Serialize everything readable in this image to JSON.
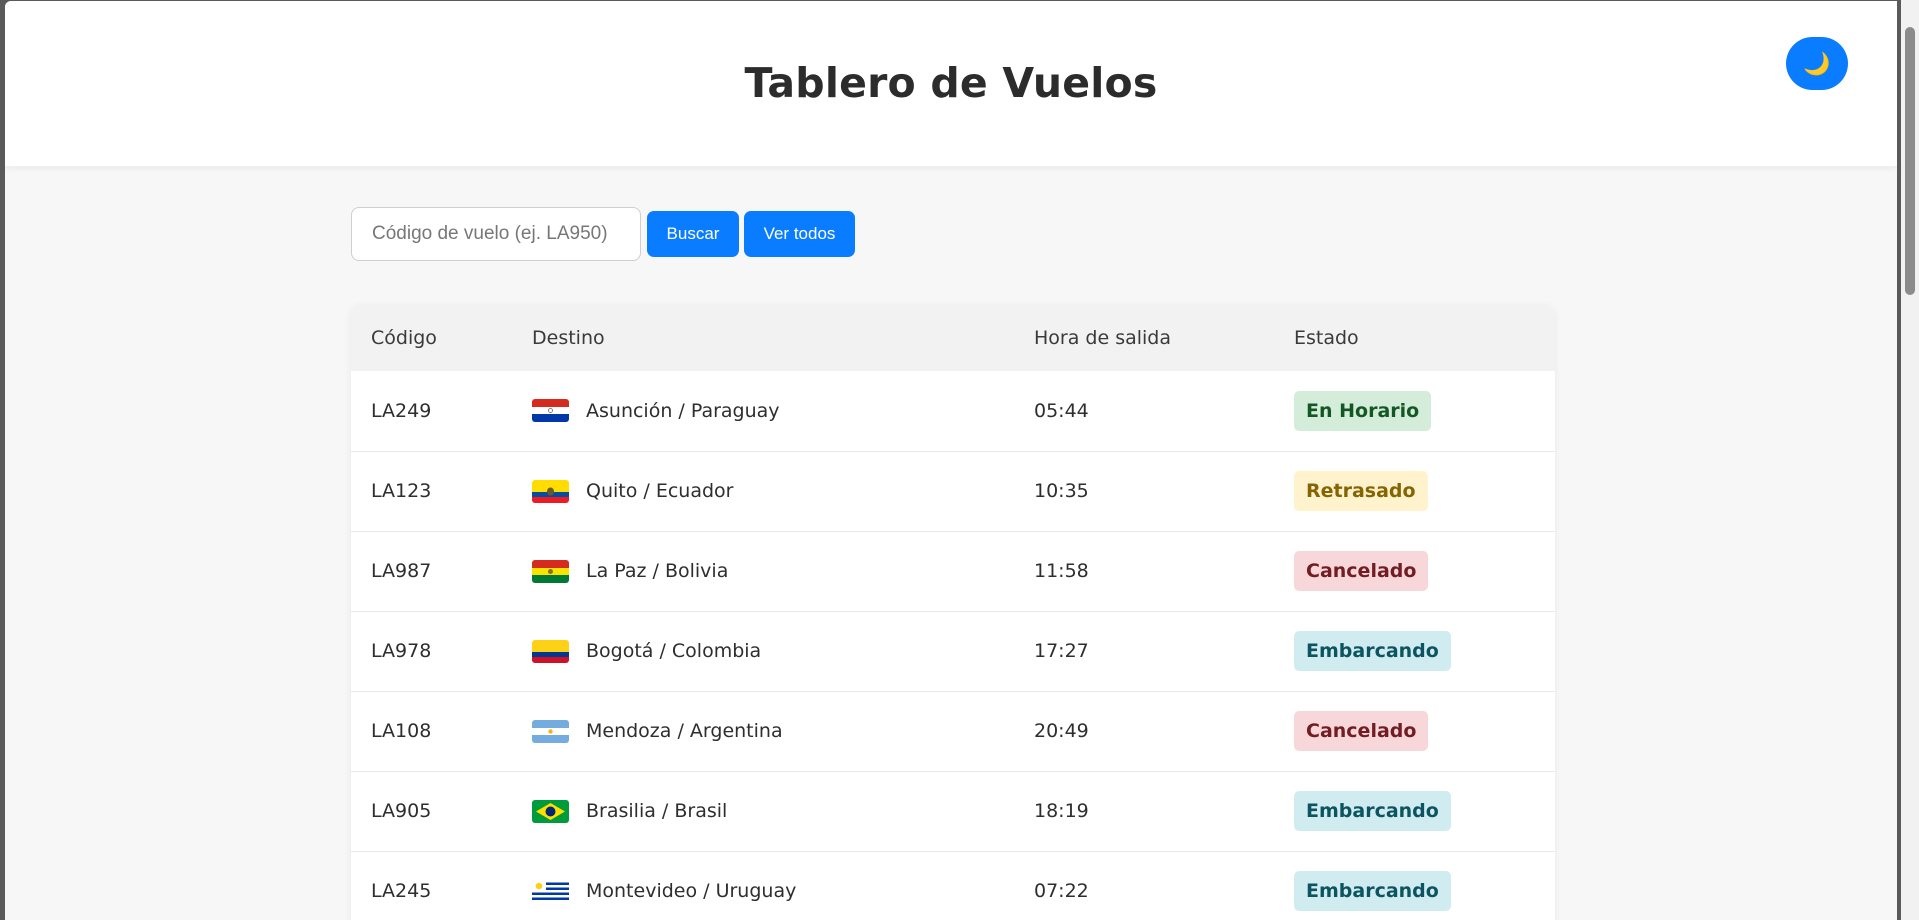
{
  "header": {
    "title": "Tablero de Vuelos",
    "theme_icon": "moon-icon",
    "theme_glyph": "🌙"
  },
  "search": {
    "placeholder": "Código de vuelo (ej. LA950)",
    "value": "",
    "search_label": "Buscar",
    "show_all_label": "Ver todos"
  },
  "table": {
    "columns": [
      "Código",
      "Destino",
      "Hora de salida",
      "Estado"
    ],
    "rows": [
      {
        "code": "LA249",
        "destination": "Asunción / Paraguay",
        "flag": "paraguay-flag-icon",
        "time": "05:44",
        "status": "En Horario"
      },
      {
        "code": "LA123",
        "destination": "Quito / Ecuador",
        "flag": "ecuador-flag-icon",
        "time": "10:35",
        "status": "Retrasado"
      },
      {
        "code": "LA987",
        "destination": "La Paz / Bolivia",
        "flag": "bolivia-flag-icon",
        "time": "11:58",
        "status": "Cancelado"
      },
      {
        "code": "LA978",
        "destination": "Bogotá / Colombia",
        "flag": "colombia-flag-icon",
        "time": "17:27",
        "status": "Embarcando"
      },
      {
        "code": "LA108",
        "destination": "Mendoza / Argentina",
        "flag": "argentina-flag-icon",
        "time": "20:49",
        "status": "Cancelado"
      },
      {
        "code": "LA905",
        "destination": "Brasilia / Brasil",
        "flag": "brasil-flag-icon",
        "time": "18:19",
        "status": "Embarcando"
      },
      {
        "code": "LA245",
        "destination": "Montevideo / Uruguay",
        "flag": "uruguay-flag-icon",
        "time": "07:22",
        "status": "Embarcando"
      }
    ]
  },
  "status_colors": {
    "En Horario": {
      "bg": "#d4edda",
      "fg": "#155724"
    },
    "Retrasado": {
      "bg": "#fff3cd",
      "fg": "#856404"
    },
    "Cancelado": {
      "bg": "#f8d7da",
      "fg": "#721c24"
    },
    "Embarcando": {
      "bg": "#d1ecf1",
      "fg": "#0c5460"
    }
  },
  "colors": {
    "accent": "#0a7cff"
  }
}
